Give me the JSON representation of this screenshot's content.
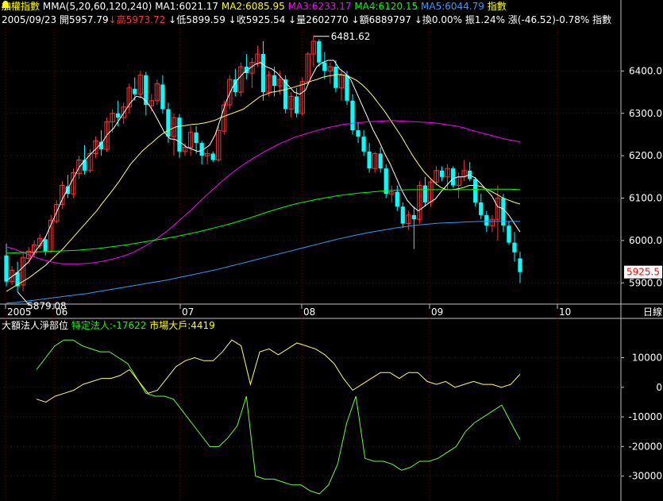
{
  "header": {
    "name": "加權指數",
    "mma_label": "MMA(5,20,60,120,240)",
    "ma1": "MA1:6021.17",
    "ma2": "MA2:6085.95",
    "ma3": "MA3:6233.17",
    "ma4": "MA4:6120.15",
    "ma5": "MA5:6044.79",
    "title": "指數",
    "date": "2005/09/23",
    "open": "開5957.79",
    "high_arrow": "↓",
    "high": "高5973.72",
    "low_arrow": "↓",
    "low": "低5899.59",
    "close_arrow": "↓",
    "close": "收5925.54",
    "vol_arrow": "↓",
    "volume": "量2602770",
    "amt_arrow": "↓",
    "amount": "額6889797",
    "turn_arrow": "↓",
    "turnover": "換0.00%",
    "amplitude": "振1.24%",
    "change": "漲(-46.52)-0.78%"
  },
  "lower_header": {
    "title": "大額法人淨部位",
    "special": "特定法人:-17622",
    "big": "市場大戶:4419"
  },
  "colors": {
    "bg": "#000000",
    "grid": "#800000",
    "axis": "#c0c0c0",
    "up": "#ff3333",
    "down": "#00ffff",
    "ma1": "#ffffff",
    "ma2": "#ffff66",
    "ma3": "#ff00ff",
    "ma4": "#00ff00",
    "ma5": "#3399ff",
    "special": "#66ff33",
    "big": "#ffff66"
  },
  "chart_data": [
    {
      "type": "candlestick",
      "title": "加權指數",
      "y_ticks": [
        5900,
        6000,
        6100,
        6200,
        6300,
        6400
      ],
      "ylim": [
        5850,
        6500
      ],
      "x_tick_labels": [
        "2005",
        "06",
        "07",
        "08",
        "09",
        "10"
      ],
      "xaxis_title": "日線",
      "last_price_label": "5925.5",
      "annotations": [
        {
          "label": "6481.62",
          "kind": "max"
        },
        {
          "label": "5879.08",
          "kind": "min"
        }
      ],
      "grid": true,
      "candles": [
        [
          5965,
          5993,
          5892,
          5903
        ],
        [
          5903,
          5940,
          5895,
          5930
        ],
        [
          5925,
          5950,
          5880,
          5892
        ],
        [
          5895,
          5975,
          5880,
          5960
        ],
        [
          5958,
          5985,
          5945,
          5975
        ],
        [
          5970,
          6000,
          5960,
          5990
        ],
        [
          5988,
          6015,
          5980,
          6005
        ],
        [
          6003,
          6010,
          5965,
          5975
        ],
        [
          5975,
          6060,
          5970,
          6048
        ],
        [
          6045,
          6095,
          6040,
          6085
        ],
        [
          6085,
          6140,
          6075,
          6130
        ],
        [
          6128,
          6155,
          6100,
          6110
        ],
        [
          6110,
          6170,
          6100,
          6160
        ],
        [
          6158,
          6200,
          6145,
          6190
        ],
        [
          6190,
          6225,
          6155,
          6165
        ],
        [
          6165,
          6215,
          6160,
          6205
        ],
        [
          6205,
          6245,
          6195,
          6235
        ],
        [
          6233,
          6260,
          6200,
          6215
        ],
        [
          6215,
          6290,
          6210,
          6280
        ],
        [
          6280,
          6310,
          6255,
          6300
        ],
        [
          6300,
          6330,
          6270,
          6290
        ],
        [
          6290,
          6325,
          6275,
          6315
        ],
        [
          6315,
          6370,
          6300,
          6360
        ],
        [
          6358,
          6385,
          6330,
          6345
        ],
        [
          6345,
          6400,
          6335,
          6390
        ],
        [
          6390,
          6398,
          6295,
          6320
        ],
        [
          6318,
          6345,
          6305,
          6330
        ],
        [
          6330,
          6380,
          6320,
          6370
        ],
        [
          6368,
          6390,
          6300,
          6310
        ],
        [
          6310,
          6325,
          6230,
          6245
        ],
        [
          6245,
          6300,
          6200,
          6290
        ],
        [
          6290,
          6298,
          6195,
          6210
        ],
        [
          6210,
          6230,
          6200,
          6220
        ],
        [
          6220,
          6270,
          6200,
          6255
        ],
        [
          6255,
          6270,
          6205,
          6230
        ],
        [
          6230,
          6235,
          6180,
          6200
        ],
        [
          6200,
          6215,
          6180,
          6205
        ],
        [
          6205,
          6210,
          6185,
          6190
        ],
        [
          6190,
          6270,
          6185,
          6260
        ],
        [
          6258,
          6330,
          6250,
          6320
        ],
        [
          6320,
          6390,
          6310,
          6380
        ],
        [
          6380,
          6405,
          6340,
          6350
        ],
        [
          6350,
          6420,
          6340,
          6410
        ],
        [
          6410,
          6440,
          6380,
          6395
        ],
        [
          6395,
          6430,
          6360,
          6420
        ],
        [
          6418,
          6460,
          6410,
          6440
        ],
        [
          6440,
          6470,
          6330,
          6350
        ],
        [
          6350,
          6400,
          6340,
          6390
        ],
        [
          6390,
          6410,
          6340,
          6365
        ],
        [
          6365,
          6400,
          6345,
          6380
        ],
        [
          6380,
          6390,
          6300,
          6310
        ],
        [
          6310,
          6350,
          6290,
          6340
        ],
        [
          6340,
          6360,
          6290,
          6300
        ],
        [
          6300,
          6385,
          6295,
          6375
        ],
        [
          6375,
          6445,
          6370,
          6440
        ],
        [
          6440,
          6481,
          6410,
          6470
        ],
        [
          6470,
          6475,
          6410,
          6420
        ],
        [
          6420,
          6445,
          6380,
          6400
        ],
        [
          6400,
          6420,
          6370,
          6410
        ],
        [
          6410,
          6425,
          6350,
          6360
        ],
        [
          6360,
          6400,
          6330,
          6390
        ],
        [
          6390,
          6400,
          6320,
          6330
        ],
        [
          6330,
          6345,
          6250,
          6260
        ],
        [
          6260,
          6280,
          6230,
          6245
        ],
        [
          6245,
          6260,
          6200,
          6210
        ],
        [
          6210,
          6230,
          6160,
          6170
        ],
        [
          6170,
          6210,
          6160,
          6205
        ],
        [
          6205,
          6220,
          6160,
          6170
        ],
        [
          6170,
          6180,
          6100,
          6110
        ],
        [
          6110,
          6130,
          6090,
          6115
        ],
        [
          6115,
          6130,
          6070,
          6080
        ],
        [
          6080,
          6090,
          6030,
          6040
        ],
        [
          6040,
          6070,
          6025,
          6060
        ],
        [
          6060,
          6080,
          5980,
          6050
        ],
        [
          6050,
          6140,
          6040,
          6130
        ],
        [
          6130,
          6150,
          6080,
          6090
        ],
        [
          6090,
          6145,
          6080,
          6138
        ],
        [
          6138,
          6175,
          6130,
          6165
        ],
        [
          6165,
          6175,
          6140,
          6150
        ],
        [
          6150,
          6180,
          6120,
          6170
        ],
        [
          6170,
          6175,
          6125,
          6130
        ],
        [
          6130,
          6160,
          6100,
          6150
        ],
        [
          6150,
          6190,
          6140,
          6165
        ],
        [
          6165,
          6185,
          6140,
          6145
        ],
        [
          6145,
          6150,
          6080,
          6090
        ],
        [
          6090,
          6110,
          6050,
          6060
        ],
        [
          6060,
          6070,
          6020,
          6035
        ],
        [
          6035,
          6060,
          6020,
          6050
        ],
        [
          6050,
          6130,
          6000,
          6100
        ],
        [
          6100,
          6110,
          6020,
          6035
        ],
        [
          6035,
          6045,
          5990,
          5995
        ],
        [
          5995,
          6020,
          5950,
          5972
        ],
        [
          5957.79,
          5973.72,
          5899.59,
          5925.54
        ]
      ],
      "series": [
        {
          "name": "MA1",
          "color": "#ffffff",
          "values": [
            5905,
            5915,
            5925,
            5938,
            5950,
            5972,
            5990,
            6010,
            6040,
            6070,
            6100,
            6125,
            6150,
            6175,
            6190,
            6205,
            6218,
            6232,
            6252,
            6265,
            6285,
            6305,
            6325,
            6340,
            6338,
            6325,
            6305,
            6280,
            6255,
            6240,
            6238,
            6230,
            6220,
            6215,
            6210,
            6215,
            6225,
            6250,
            6290,
            6330,
            6360,
            6380,
            6395,
            6405,
            6415,
            6420,
            6410,
            6405,
            6395,
            6380,
            6365,
            6350,
            6345,
            6355,
            6385,
            6410,
            6420,
            6425,
            6425,
            6405,
            6395,
            6380,
            6350,
            6320,
            6290,
            6260,
            6235,
            6205,
            6180,
            6150,
            6120,
            6095,
            6080,
            6070,
            6080,
            6090,
            6098,
            6115,
            6130,
            6145,
            6150,
            6150,
            6155,
            6148,
            6135,
            6120,
            6105,
            6080,
            6075,
            6060,
            6040,
            6020
          ]
        },
        {
          "name": "MA2",
          "color": "#ffff66",
          "values": [
            5880,
            5888,
            5896,
            5904,
            5912,
            5922,
            5932,
            5942,
            5955,
            5968,
            5980,
            5995,
            6010,
            6025,
            6040,
            6055,
            6070,
            6088,
            6105,
            6122,
            6140,
            6160,
            6180,
            6195,
            6210,
            6222,
            6233,
            6245,
            6255,
            6262,
            6268,
            6270,
            6272,
            6274,
            6275,
            6277,
            6280,
            6284,
            6290,
            6295,
            6300,
            6305,
            6310,
            6320,
            6330,
            6340,
            6345,
            6350,
            6352,
            6355,
            6358,
            6362,
            6366,
            6370,
            6376,
            6380,
            6385,
            6388,
            6390,
            6392,
            6390,
            6385,
            6378,
            6368,
            6355,
            6340,
            6322,
            6305,
            6285,
            6265,
            6245,
            6222,
            6200,
            6180,
            6162,
            6148,
            6135,
            6125,
            6120,
            6120,
            6122,
            6125,
            6130,
            6130,
            6128,
            6122,
            6115,
            6108,
            6100,
            6095,
            6090,
            6086
          ]
        },
        {
          "name": "MA3",
          "color": "#ff00ff",
          "values": [
            5985,
            5980,
            5972,
            5965,
            5958,
            5952,
            5948,
            5945,
            5945,
            5945,
            5946,
            5948,
            5951,
            5955,
            5960,
            5966,
            5974,
            5984,
            5995,
            6008,
            6022,
            6038,
            6055,
            6072,
            6090,
            6108,
            6125,
            6142,
            6158,
            6172,
            6185,
            6197,
            6208,
            6218,
            6228,
            6236,
            6244,
            6250,
            6256,
            6261,
            6266,
            6270,
            6274,
            6276,
            6278,
            6280,
            6281,
            6282,
            6283,
            6282,
            6281,
            6280,
            6279,
            6278,
            6276,
            6273,
            6270,
            6266,
            6260,
            6255,
            6250,
            6245,
            6240,
            6236,
            6233
          ]
        },
        {
          "name": "MA4",
          "color": "#00ff00",
          "values": [
            5970,
            5971,
            5972,
            5973,
            5974,
            5975,
            5976,
            5977,
            5979,
            5981,
            5984,
            5987,
            5990,
            5994,
            5998,
            6002,
            6006,
            6010,
            6015,
            6020,
            6026,
            6032,
            6038,
            6045,
            6052,
            6060,
            6068,
            6075,
            6082,
            6088,
            6093,
            6098,
            6102,
            6106,
            6109,
            6112,
            6114,
            6116,
            6118,
            6119,
            6120,
            6120,
            6120,
            6120,
            6120,
            6120,
            6120,
            6121,
            6121,
            6121,
            6121,
            6120
          ]
        },
        {
          "name": "MA5",
          "color": "#3399ff",
          "values": [
            5852,
            5854,
            5857,
            5860,
            5863,
            5866,
            5869,
            5872,
            5875,
            5879,
            5883,
            5887,
            5891,
            5895,
            5899,
            5903,
            5907,
            5912,
            5917,
            5922,
            5927,
            5932,
            5938,
            5944,
            5950,
            5956,
            5962,
            5968,
            5974,
            5980,
            5986,
            5992,
            5998,
            6004,
            6009,
            6014,
            6019,
            6023,
            6027,
            6031,
            6034,
            6037,
            6039,
            6041,
            6042,
            6043,
            6044,
            6045,
            6045,
            6045,
            6045,
            6045
          ]
        }
      ]
    },
    {
      "type": "line",
      "title": "大額法人淨部位",
      "y_ticks": [
        10000,
        0,
        -10000,
        -20000,
        -30000
      ],
      "ylim": [
        -36000,
        19000
      ],
      "grid": true,
      "series": [
        {
          "name": "特定法人",
          "color": "#66ff33",
          "values": [
            6000,
            10000,
            14000,
            16000,
            16000,
            14000,
            13000,
            12000,
            12000,
            10000,
            8000,
            3000,
            -2000,
            -3000,
            -3000,
            -4000,
            -8000,
            -12000,
            -16000,
            -20000,
            -20000,
            -17000,
            -13000,
            -3000,
            -30000,
            -31000,
            -31000,
            -32000,
            -33000,
            -33000,
            -35000,
            -36000,
            -33000,
            -26000,
            -12000,
            -3000,
            -24000,
            -25000,
            -25000,
            -26000,
            -28000,
            -27000,
            -25000,
            -25000,
            -24000,
            -22000,
            -20000,
            -15000,
            -12000,
            -10000,
            -8000,
            -6000,
            -12000,
            -17622
          ]
        },
        {
          "name": "市場大戶",
          "color": "#ffff66",
          "values": [
            -4000,
            -5000,
            -3000,
            -2000,
            -1000,
            1000,
            2000,
            3000,
            3000,
            4000,
            6000,
            2000,
            -2000,
            -1000,
            3000,
            7000,
            9000,
            10000,
            9000,
            9000,
            12000,
            16000,
            14000,
            1000,
            12000,
            13000,
            11000,
            13000,
            15000,
            14000,
            13000,
            11000,
            8000,
            3000,
            -1000,
            1000,
            3000,
            5000,
            5000,
            3000,
            5000,
            5000,
            2000,
            1000,
            2000,
            0,
            1000,
            2000,
            1000,
            1000,
            0,
            1000,
            4419
          ]
        }
      ]
    }
  ]
}
